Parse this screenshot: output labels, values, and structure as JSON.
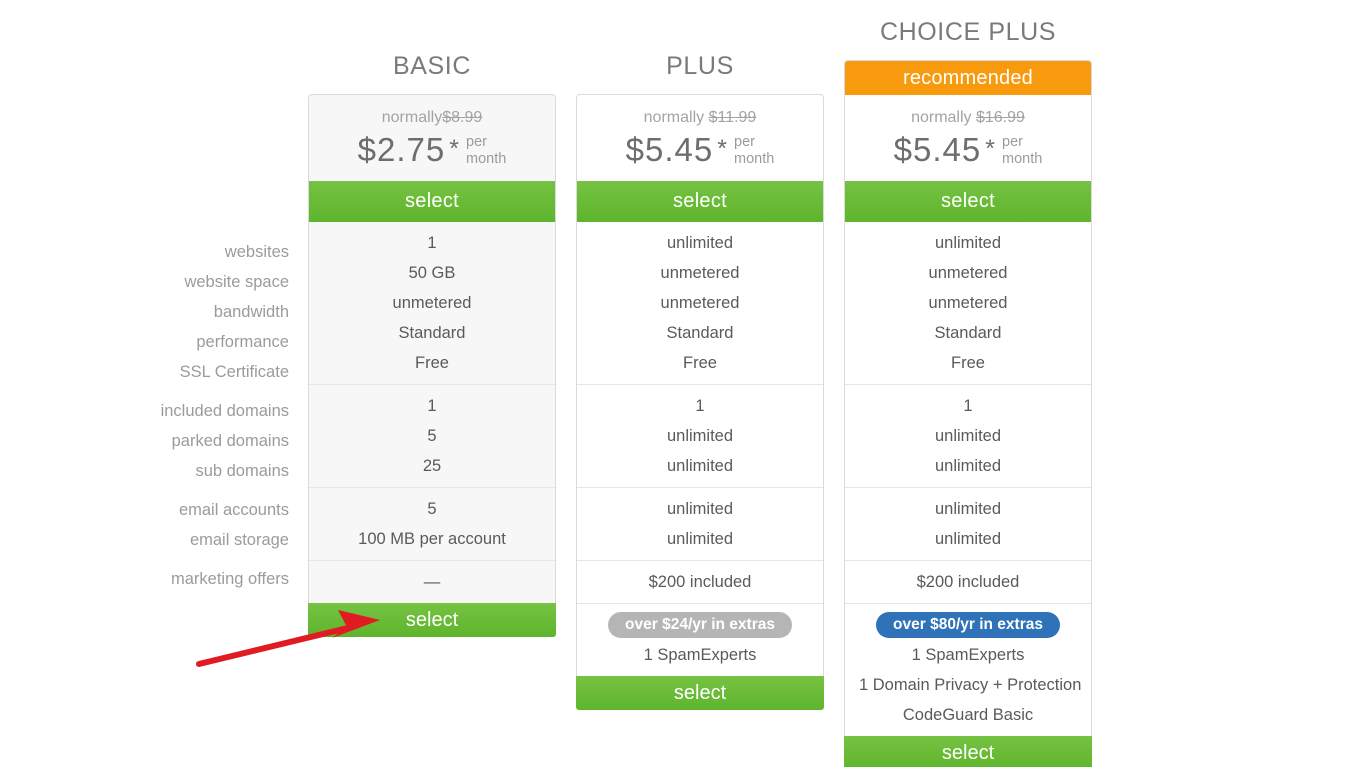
{
  "feature_labels": [
    {
      "group": 0,
      "label": "websites"
    },
    {
      "group": 0,
      "label": "website space"
    },
    {
      "group": 0,
      "label": "bandwidth"
    },
    {
      "group": 0,
      "label": "performance"
    },
    {
      "group": 0,
      "label": "SSL Certificate"
    },
    {
      "group": 1,
      "label": "included domains"
    },
    {
      "group": 1,
      "label": "parked domains"
    },
    {
      "group": 1,
      "label": "sub domains"
    },
    {
      "group": 2,
      "label": "email accounts"
    },
    {
      "group": 2,
      "label": "email storage"
    },
    {
      "group": 3,
      "label": "marketing offers"
    }
  ],
  "labels": {
    "websites": "websites",
    "website_space": "website space",
    "bandwidth": "bandwidth",
    "performance": "performance",
    "ssl_certificate": "SSL Certificate",
    "included_domains": "included domains",
    "parked_domains": "parked domains",
    "sub_domains": "sub domains",
    "email_accounts": "email accounts",
    "email_storage": "email storage",
    "marketing_offers": "marketing offers"
  },
  "colors": {
    "select_green": "#62bb33",
    "recommended_orange": "#f89a0d",
    "badge_gray": "#b5b5b5",
    "badge_blue": "#2f72b7",
    "label_text": "#9b9b9b",
    "value_text": "#5a5a5a",
    "arrow_red": "#e01b22",
    "card_border": "#dadada",
    "card_tint": "#f7f7f7"
  },
  "plans": {
    "basic": {
      "title": "BASIC",
      "ribbon": null,
      "normally_prefix": "normally",
      "normally_price": "$8.99",
      "price": "$2.75",
      "star": "*",
      "per": "per",
      "month": "month",
      "select_top_label": "select",
      "select_bottom_label": "select",
      "websites": "1",
      "website_space": "50 GB",
      "bandwidth": "unmetered",
      "performance": "Standard",
      "ssl_certificate": "Free",
      "included_domains": "1",
      "parked_domains": "5",
      "sub_domains": "25",
      "email_accounts": "5",
      "email_storage": "100 MB per account",
      "marketing_offers": "—",
      "extras_badge": null,
      "extras": []
    },
    "plus": {
      "title": "PLUS",
      "ribbon": null,
      "normally_prefix": "normally",
      "normally_price": "$11.99",
      "price": "$5.45",
      "star": "*",
      "per": "per",
      "month": "month",
      "select_top_label": "select",
      "select_bottom_label": "select",
      "websites": "unlimited",
      "website_space": "unmetered",
      "bandwidth": "unmetered",
      "performance": "Standard",
      "ssl_certificate": "Free",
      "included_domains": "1",
      "parked_domains": "unlimited",
      "sub_domains": "unlimited",
      "email_accounts": "unlimited",
      "email_storage": "unlimited",
      "marketing_offers": "$200 included",
      "extras_badge": "over $24/yr in extras",
      "extras": [
        "1 SpamExperts"
      ]
    },
    "choice_plus": {
      "title": "CHOICE PLUS",
      "ribbon": "recommended",
      "normally_prefix": "normally",
      "normally_price": "$16.99",
      "price": "$5.45",
      "star": "*",
      "per": "per",
      "month": "month",
      "select_top_label": "select",
      "select_bottom_label": "select",
      "websites": "unlimited",
      "website_space": "unmetered",
      "bandwidth": "unmetered",
      "performance": "Standard",
      "ssl_certificate": "Free",
      "included_domains": "1",
      "parked_domains": "unlimited",
      "sub_domains": "unlimited",
      "email_accounts": "unlimited",
      "email_storage": "unlimited",
      "marketing_offers": "$200 included",
      "extras_badge": "over $80/yr in extras",
      "extras": [
        "1 SpamExperts",
        "1 Domain Privacy + Protection",
        "CodeGuard Basic"
      ]
    }
  },
  "annotation": {
    "type": "red-arrow",
    "points_to": "basic-bottom-select-button"
  }
}
